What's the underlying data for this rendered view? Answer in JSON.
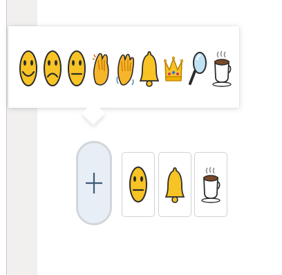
{
  "emoji_picker": {
    "items": [
      {
        "name": "slightly-smiling-face",
        "icon": "smile-icon"
      },
      {
        "name": "frowning-face",
        "icon": "frown-icon"
      },
      {
        "name": "neutral-face",
        "icon": "neutral-face-icon"
      },
      {
        "name": "clapping-hands",
        "icon": "clap-icon"
      },
      {
        "name": "waving-hand",
        "icon": "wave-icon"
      },
      {
        "name": "bell",
        "icon": "bell-icon"
      },
      {
        "name": "crown",
        "icon": "crown-icon"
      },
      {
        "name": "magnifying-glass",
        "icon": "magnifier-icon"
      },
      {
        "name": "hot-beverage",
        "icon": "coffee-icon"
      }
    ]
  },
  "add_reaction": {
    "icon": "plus-icon"
  },
  "reactions": [
    {
      "name": "neutral-face",
      "icon": "neutral-face-icon"
    },
    {
      "name": "bell",
      "icon": "bell-icon"
    },
    {
      "name": "hot-beverage",
      "icon": "coffee-icon"
    }
  ],
  "colors": {
    "emoji_yellow": "#f7c325",
    "emoji_outline": "#d49a00",
    "add_button_bg": "#e7eef6",
    "add_button_border": "#d2d6da",
    "plus": "#3e5a74",
    "reaction_border": "#cfd2d5",
    "sidebar_bg": "#f1f0ef"
  }
}
